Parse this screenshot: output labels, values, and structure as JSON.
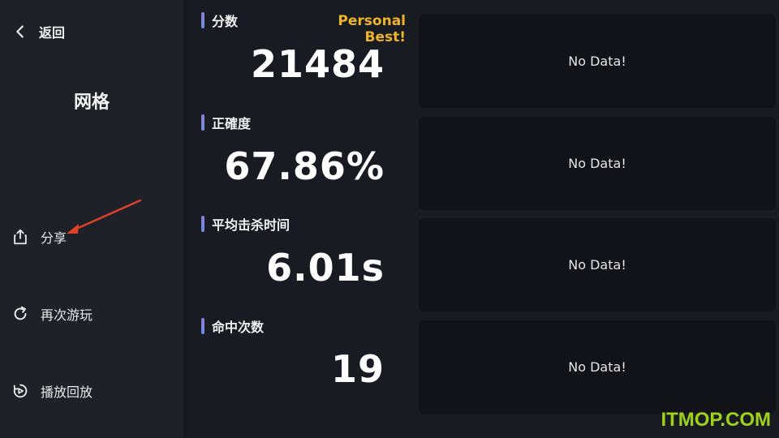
{
  "sidebar": {
    "back_label": "返回",
    "mode_title": "网格",
    "items": [
      {
        "label": "分享",
        "icon": "share-icon"
      },
      {
        "label": "再次游玩",
        "icon": "replay-icon"
      },
      {
        "label": "播放回放",
        "icon": "playback-icon"
      }
    ]
  },
  "stats": [
    {
      "label": "分数",
      "value": "21484",
      "badge": "Personal Best!"
    },
    {
      "label": "正確度",
      "value": "67.86%"
    },
    {
      "label": "平均击杀时间",
      "value": "6.01s"
    },
    {
      "label": "命中次数",
      "value": "19"
    }
  ],
  "charts": [
    {
      "message": "No Data!"
    },
    {
      "message": "No Data!"
    },
    {
      "message": "No Data!"
    },
    {
      "message": "No Data!"
    }
  ],
  "colors": {
    "accent_gold": "#f0b429",
    "annotation_red": "#e0402a",
    "watermark_green": "#9fd11a"
  },
  "watermark": "ITMOP.COM"
}
